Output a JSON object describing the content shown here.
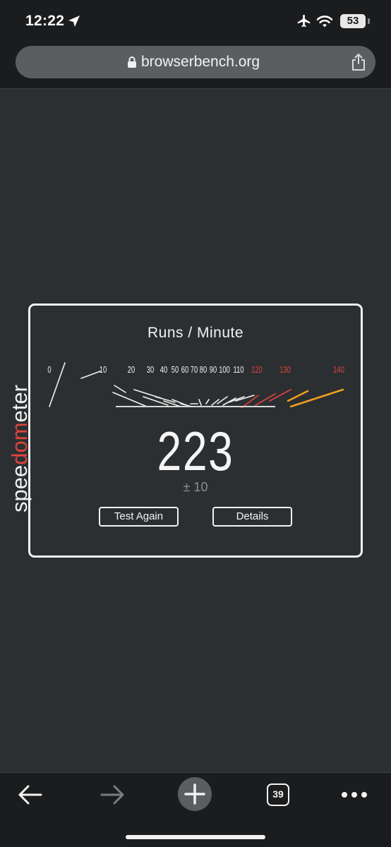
{
  "status_bar": {
    "time": "12:22",
    "battery": "53"
  },
  "address_bar": {
    "url": "browserbench.org"
  },
  "speedometer": {
    "brand": "speedometer",
    "title": "Runs / Minute",
    "score": "223",
    "margin": "± 10",
    "test_again_label": "Test Again",
    "details_label": "Details",
    "scale_labels": [
      "0",
      "10",
      "20",
      "30",
      "40",
      "50",
      "60",
      "70",
      "80",
      "90",
      "100",
      "110",
      "120",
      "130",
      "140"
    ],
    "red_start": "120",
    "colors": {
      "normal": "#f2f2f2",
      "red": "#e0443e",
      "orange": "#f0a020",
      "brand_accent": "#e0443e"
    }
  },
  "toolbar": {
    "tabs_count": "39"
  },
  "icons": [
    "location-arrow-icon",
    "airplane-icon",
    "wifi-icon",
    "lock-icon",
    "share-icon",
    "back-arrow-icon",
    "forward-arrow-icon",
    "plus-icon",
    "more-icon"
  ]
}
